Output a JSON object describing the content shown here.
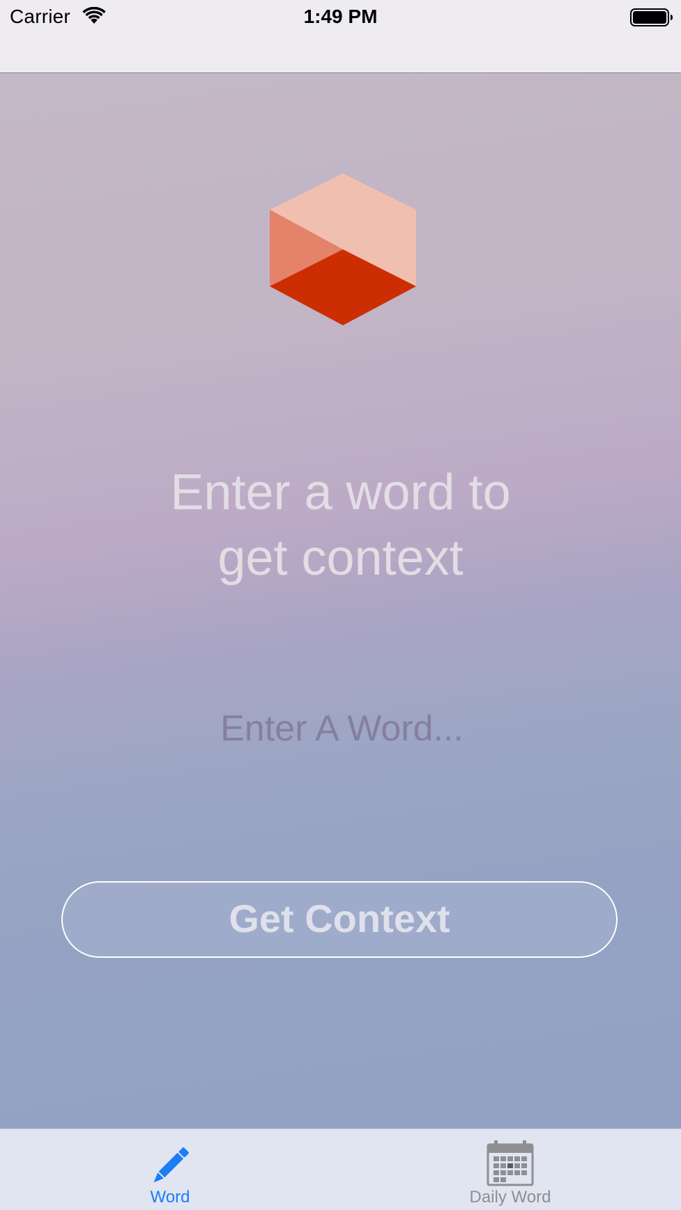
{
  "status_bar": {
    "carrier": "Carrier",
    "time": "1:49 PM",
    "wifi_icon": "wifi-icon",
    "battery_icon": "battery-icon"
  },
  "main": {
    "logo_icon": "hexagon-cube-logo",
    "headline_line1": "Enter a word to",
    "headline_line2": "get context",
    "word_input": {
      "value": "",
      "placeholder": "Enter A Word..."
    },
    "get_context_label": "Get Context"
  },
  "tab_bar": {
    "tabs": [
      {
        "label": "Word",
        "icon": "pencil-icon",
        "selected": true
      },
      {
        "label": "Daily Word",
        "icon": "calendar-icon",
        "selected": false
      }
    ]
  },
  "colors": {
    "accent": "#1a7ef5",
    "inactive_tab": "#8e8e93",
    "logo_dark": "#cc2e02",
    "logo_mid": "#e4826a",
    "logo_light": "#f1bfb0"
  }
}
